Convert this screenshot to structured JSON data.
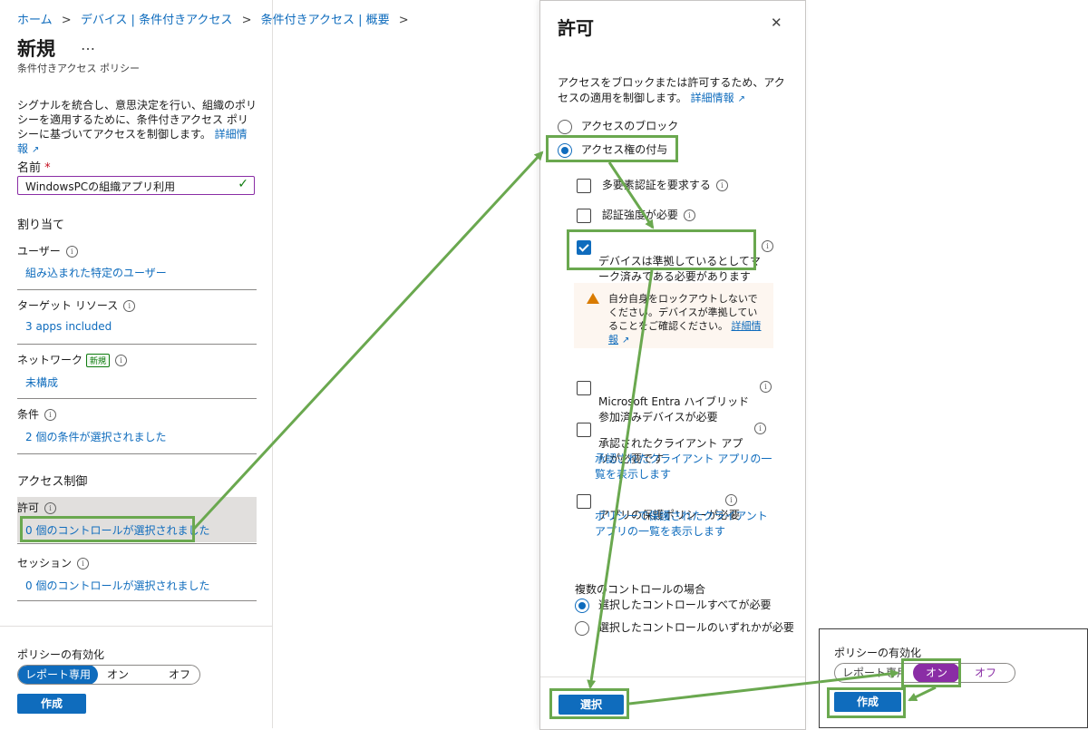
{
  "breadcrumb": [
    "ホーム",
    "デバイス | 条件付きアクセス",
    "条件付きアクセス | 概要"
  ],
  "breadcrumb_sep": ">",
  "page": {
    "title": "新規",
    "more": "…",
    "subtitle": "条件付きアクセス ポリシー",
    "description": "シグナルを統合し、意思決定を行い、組織のポリシーを適用するために、条件付きアクセス ポリシーに基づいてアクセスを制御します。",
    "learn_more": "詳細情報"
  },
  "name_field": {
    "label": "名前",
    "required": "*",
    "value": "WindowsPCの組織アプリ利用",
    "check": "✓"
  },
  "assignments": {
    "heading": "割り当て",
    "users_label": "ユーザー",
    "users_value": "組み込まれた特定のユーザー",
    "target_label": "ターゲット リソース",
    "target_value": "3 apps included",
    "network_label": "ネットワーク",
    "network_badge": "新規",
    "network_value": "未構成",
    "conditions_label": "条件",
    "conditions_value": "2 個の条件が選択されました"
  },
  "access_controls": {
    "heading": "アクセス制御",
    "grant_label": "許可",
    "grant_value": "0 個のコントロールが選択されました",
    "session_label": "セッション",
    "session_value": "0 個のコントロールが選択されました"
  },
  "enable_policy": {
    "label": "ポリシーの有効化",
    "options": [
      "レポート専用",
      "オン",
      "オフ"
    ],
    "selected": "レポート専用",
    "create_button": "作成"
  },
  "grant_panel": {
    "title": "許可",
    "close": "✕",
    "description": "アクセスをブロックまたは許可するため、アクセスの適用を制御します。",
    "learn_more": "詳細情報",
    "radio_block": "アクセスのブロック",
    "radio_grant": "アクセス権の付与",
    "options": [
      {
        "label": "多要素認証を要求する",
        "checked": false
      },
      {
        "label": "認証強度が必要",
        "checked": false
      },
      {
        "label": "デバイスは準拠しているとしてマーク済みである必要があります",
        "checked": true
      }
    ],
    "warning": "自分自身をロックアウトしないでください。デバイスが準拠していることをご確認ください。",
    "warning_link": "詳細情報",
    "options2": [
      {
        "label": "Microsoft Entra ハイブリッド参加済みデバイスが必要",
        "checked": false
      },
      {
        "label": "承認されたクライアント アプリが必要です",
        "checked": false,
        "link": "承認されたクライアント アプリの一覧を表示します"
      },
      {
        "label": "アプリの保護ポリシーが必要",
        "checked": false,
        "link": "ポリシーで保護されたクライアント アプリの一覧を表示します"
      }
    ],
    "multi_heading": "複数のコントロールの場合",
    "multi_all": "選択したコントロールすべてが必要",
    "multi_any": "選択したコントロールのいずれかが必要",
    "select_button": "選択"
  },
  "mini_panel": {
    "label": "ポリシーの有効化",
    "options": [
      "レポート専用",
      "オン",
      "オフ"
    ],
    "selected": "オン",
    "create_button": "作成"
  },
  "colors": {
    "link": "#0f6cbd",
    "primary": "#0f6cbd",
    "annotation": "#6aa84f",
    "toggle_on": "#8a2da5",
    "warning": "#d97b00"
  }
}
